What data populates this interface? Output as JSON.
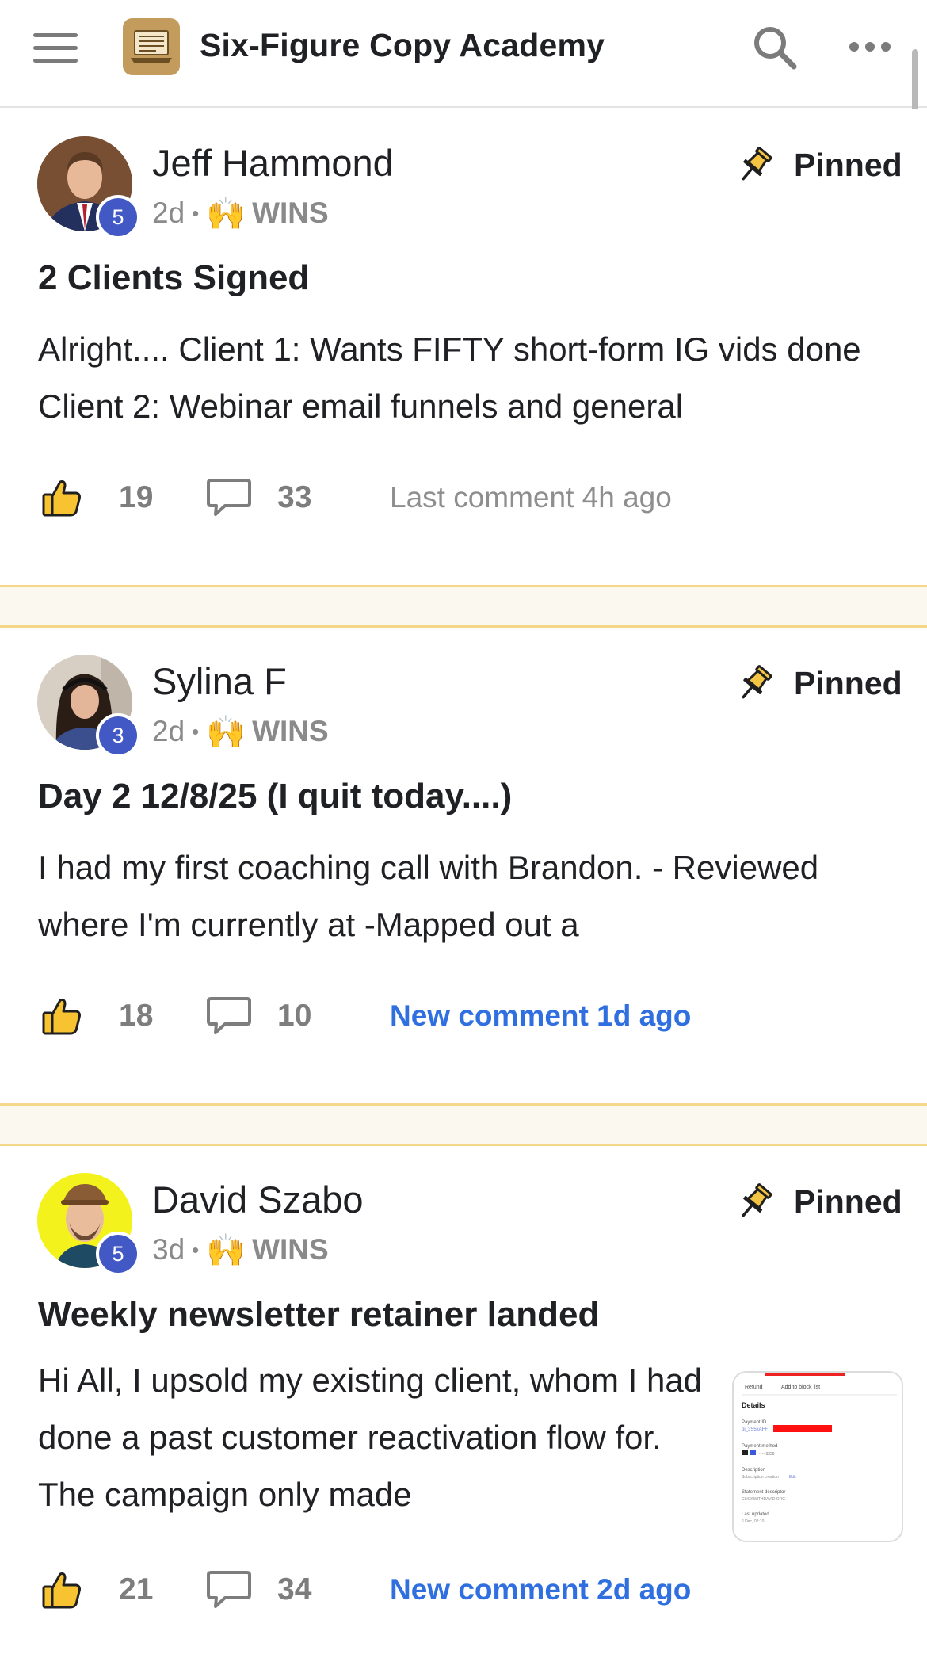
{
  "header": {
    "title": "Six-Figure Copy Academy",
    "logo_icon": "laptop-logo-icon",
    "menu_icon": "hamburger-menu-icon",
    "search_icon": "search-icon",
    "more_icon": "more-horizontal-icon"
  },
  "colors": {
    "accent_blue": "#2f6fe0",
    "level_badge": "#4258c4",
    "separator_border": "#f5d78a",
    "brand_gold": "#c29b5d"
  },
  "posts": [
    {
      "author": "Jeff Hammond",
      "level": "5",
      "time": "2d",
      "category_emoji": "🙌",
      "category": "WINS",
      "pinned_label": "Pinned",
      "title": "2 Clients Signed",
      "body": "Alright.... Client 1: Wants FIFTY short-form IG vids done Client 2: Webinar email funnels and general",
      "likes": "19",
      "comments": "33",
      "activity": "Last comment 4h ago"
    },
    {
      "author": "Sylina F",
      "level": "3",
      "time": "2d",
      "category_emoji": "🙌",
      "category": "WINS",
      "pinned_label": "Pinned",
      "title": "Day 2 12/8/25 (I quit today....)",
      "body": "I had my first coaching call with Brandon. - Reviewed where I'm currently at -Mapped out a",
      "likes": "18",
      "comments": "10",
      "activity": "New comment 1d ago"
    },
    {
      "author": "David Szabo",
      "level": "5",
      "time": "3d",
      "category_emoji": "🙌",
      "category": "WINS",
      "pinned_label": "Pinned",
      "title": "Weekly newsletter retainer landed",
      "body": "Hi All, I upsold my existing client, whom I had done a past customer reactivation flow for. The campaign only made",
      "likes": "21",
      "comments": "34",
      "activity": "New comment 2d ago",
      "attachment": {
        "refund": "Refund",
        "block_list": "Add to block list",
        "section": "Details",
        "payment_id_label": "Payment ID",
        "payment_id_value": "pi_3S5xAFF",
        "payment_method_label": "Payment method",
        "payment_method_value": "•••• 3229",
        "description_label": "Description",
        "description_value": "Subscription creation",
        "description_edit": "Edit",
        "statement_label": "Statement descriptor",
        "statement_value": "CLICKWITHDAVID.ORG",
        "updated_label": "Last updated",
        "updated_value": "6 Dec, 02:10"
      }
    }
  ]
}
